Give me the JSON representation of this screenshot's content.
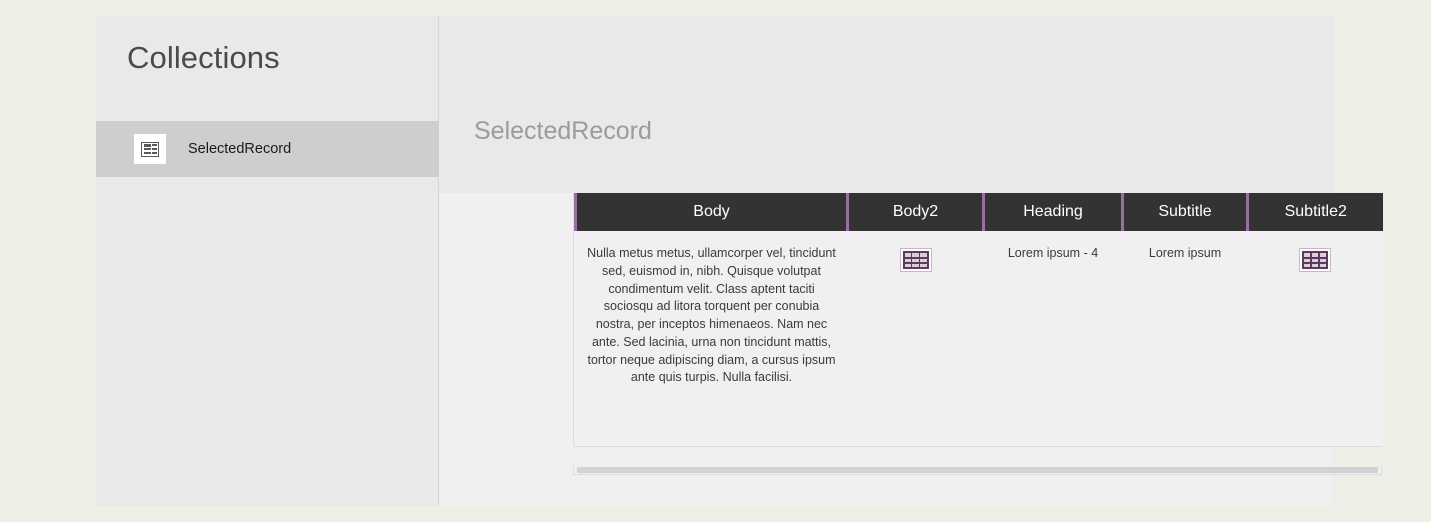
{
  "sidebar": {
    "title": "Collections",
    "items": [
      {
        "label": "SelectedRecord",
        "icon": "record-icon",
        "selected": true
      }
    ]
  },
  "main": {
    "title": "SelectedRecord"
  },
  "table": {
    "columns": [
      {
        "key": "body",
        "label": "Body"
      },
      {
        "key": "body2",
        "label": "Body2"
      },
      {
        "key": "heading",
        "label": "Heading"
      },
      {
        "key": "subtitle",
        "label": "Subtitle"
      },
      {
        "key": "subtitle2",
        "label": "Subtitle2"
      }
    ],
    "rows": [
      {
        "body": "Nulla metus metus, ullamcorper vel, tincidunt sed, euismod in, nibh. Quisque volutpat condimentum velit. Class aptent taciti sociosqu ad litora torquent per conubia nostra, per inceptos himenaeos. Nam nec ante. Sed lacinia, urna non tincidunt mattis, tortor neque adipiscing diam, a cursus ipsum ante quis turpis. Nulla facilisi.",
        "body2": "table-icon",
        "heading": "Lorem ipsum - 4",
        "subtitle": "Lorem ipsum",
        "subtitle2": "table-icon"
      }
    ]
  },
  "colors": {
    "page_background": "#eeeee6",
    "panel_background": "#e9e9e9",
    "main_background": "#f0f0f0",
    "sidebar_selected": "#cecece",
    "header_dark": "#333333",
    "accent_purple": "#9a6ea3",
    "icon_purple": "#5e3a5e"
  },
  "scrollbar": {
    "orientation": "horizontal",
    "thumb_position": "full"
  }
}
